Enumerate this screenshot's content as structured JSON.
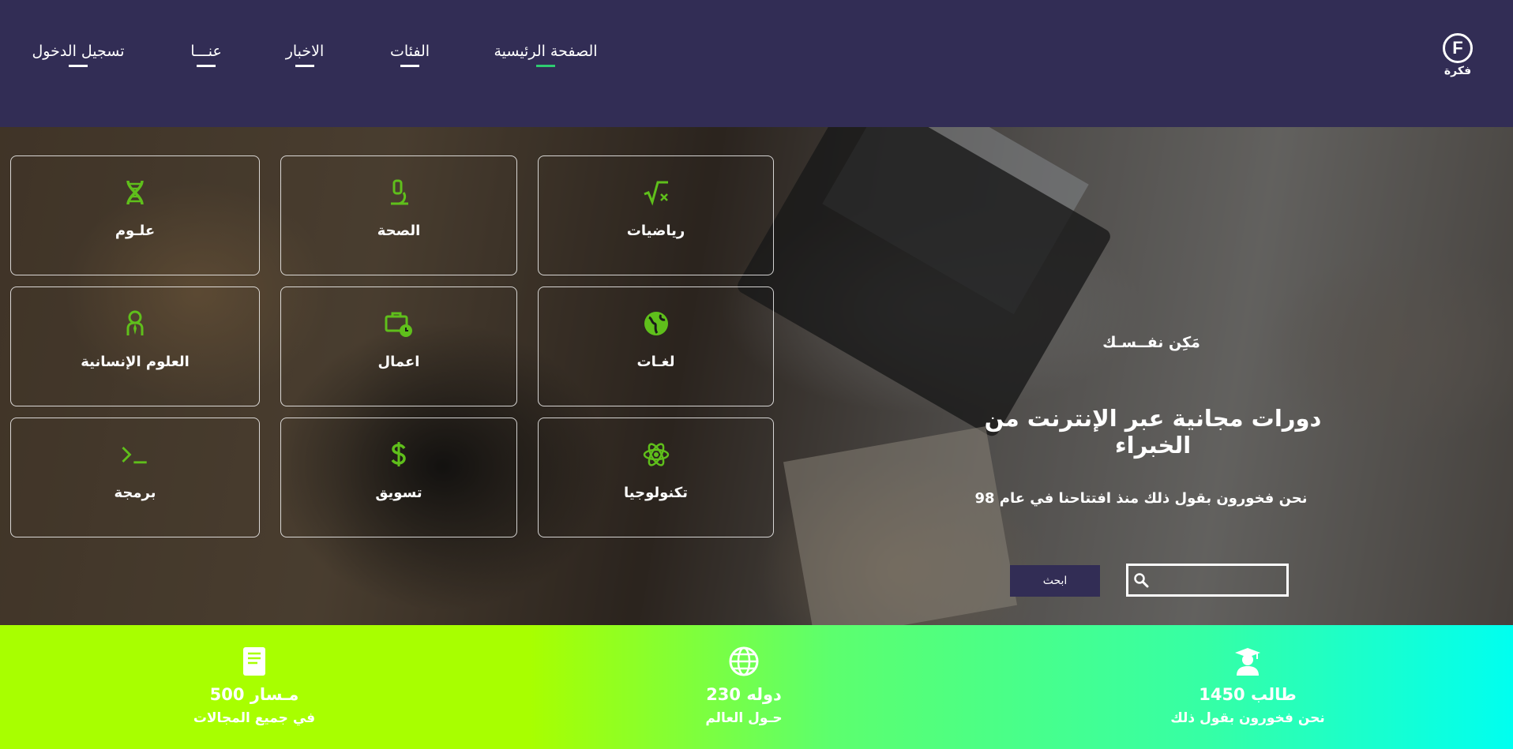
{
  "header": {
    "logo_letter": "F",
    "logo_text": "فكرة",
    "nav": [
      {
        "label": "الصفحة الرئيسية",
        "active": true
      },
      {
        "label": "الفئات"
      },
      {
        "label": "الاخبار"
      },
      {
        "label": "عنـــا"
      },
      {
        "label": "تسجيل الدخول"
      }
    ]
  },
  "hero": {
    "tagline": "مَكِن نفــسـك",
    "title": "دورات مجانية عبر الإنترنت من الخبراء",
    "subtitle": "نحن فخورون بقول ذلك منذ افتتاحنا في عام 98",
    "search": {
      "value": "",
      "button_label": "ابحث",
      "icon": "search-icon"
    }
  },
  "categories": [
    {
      "label": "رياضيات",
      "icon": "square-root-icon"
    },
    {
      "label": "الصحة",
      "icon": "microscope-icon"
    },
    {
      "label": "علـوم",
      "icon": "dna-icon"
    },
    {
      "label": "لغـات",
      "icon": "globe-icon"
    },
    {
      "label": "اعمال",
      "icon": "briefcase-clock-icon"
    },
    {
      "label": "العلوم الإنسانية",
      "icon": "user-tie-icon"
    },
    {
      "label": "تكنولوجيا",
      "icon": "atom-icon"
    },
    {
      "label": "تسويق",
      "icon": "dollar-icon"
    },
    {
      "label": "برمجة",
      "icon": "terminal-icon"
    }
  ],
  "stats": [
    {
      "value": "1450 طالب",
      "caption": "نحن فخورون بقول ذلك",
      "icon": "graduate-icon"
    },
    {
      "value": "230 دوله",
      "caption": "حـول العالم",
      "icon": "globe-icon"
    },
    {
      "value": "500 مـسار",
      "caption": "في جميع المجالات",
      "icon": "book-icon"
    }
  ],
  "colors": {
    "header_bg": "#322d55",
    "accent_green": "#5fbf1b",
    "active_underline": "#2ecc71",
    "stats_gradient_start": "#a8ff00",
    "stats_gradient_end": "#00fff0"
  }
}
